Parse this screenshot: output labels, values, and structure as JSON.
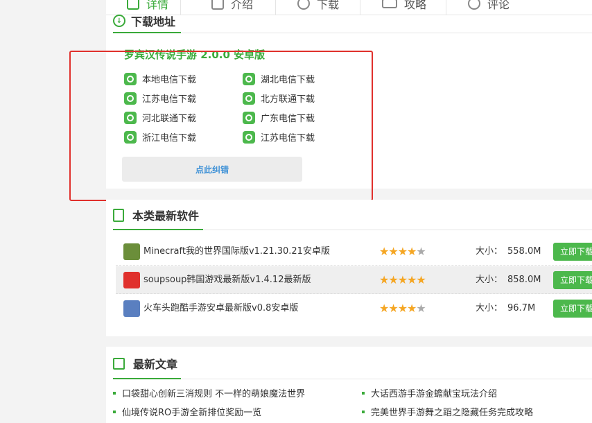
{
  "tabs": [
    {
      "label": "详情",
      "icon": "document-icon",
      "active": true
    },
    {
      "label": "介绍",
      "icon": "intro-icon",
      "active": false
    },
    {
      "label": "下载",
      "icon": "download-icon",
      "active": false
    },
    {
      "label": "攻略",
      "icon": "layers-icon",
      "active": false
    },
    {
      "label": "评论",
      "icon": "comment-icon",
      "active": false
    }
  ],
  "download": {
    "heading": "下载地址",
    "title": "罗宾汉传说手游 2.0.0 安卓版",
    "links": [
      "本地电信下载",
      "湖北电信下载",
      "江苏电信下载",
      "北方联通下载",
      "河北联通下载",
      "广东电信下载",
      "浙江电信下载",
      "江苏电信下载"
    ],
    "fix_button": "点此纠错"
  },
  "software": {
    "heading": "本类最新软件",
    "size_label": "大小：",
    "items": [
      {
        "name": "Minecraft我的世界国际版v1.21.30.21安卓版",
        "rating": 4,
        "size": "558.0M",
        "button": "立即下载",
        "icon": "minecraft-icon",
        "color": "#6b8e3a"
      },
      {
        "name": "soupsoup韩国游戏最新版v1.4.12最新版",
        "rating": 5,
        "size": "858.0M",
        "button": "立即下载",
        "icon": "soupsoup-icon",
        "color": "#e0302c"
      },
      {
        "name": "火车头跑酷手游安卓最新版v0.8安卓版",
        "rating": 4,
        "size": "96.7M",
        "button": "立即下载",
        "icon": "train-runner-icon",
        "color": "#5a7fc0"
      }
    ]
  },
  "articles": {
    "heading": "最新文章",
    "items": [
      "口袋甜心创新三消规则 不一样的萌娘魔法世界",
      "大话西游手游金蟾献宝玩法介绍",
      "仙境传说RO手游全新排位奖励一览",
      "完美世界手游舞之蹈之隐藏任务完成攻略"
    ]
  },
  "colors": {
    "accent": "#3aaa3a",
    "highlight_border": "#e0302c",
    "link_blue": "#3a8fd6",
    "star": "#f5a623"
  }
}
